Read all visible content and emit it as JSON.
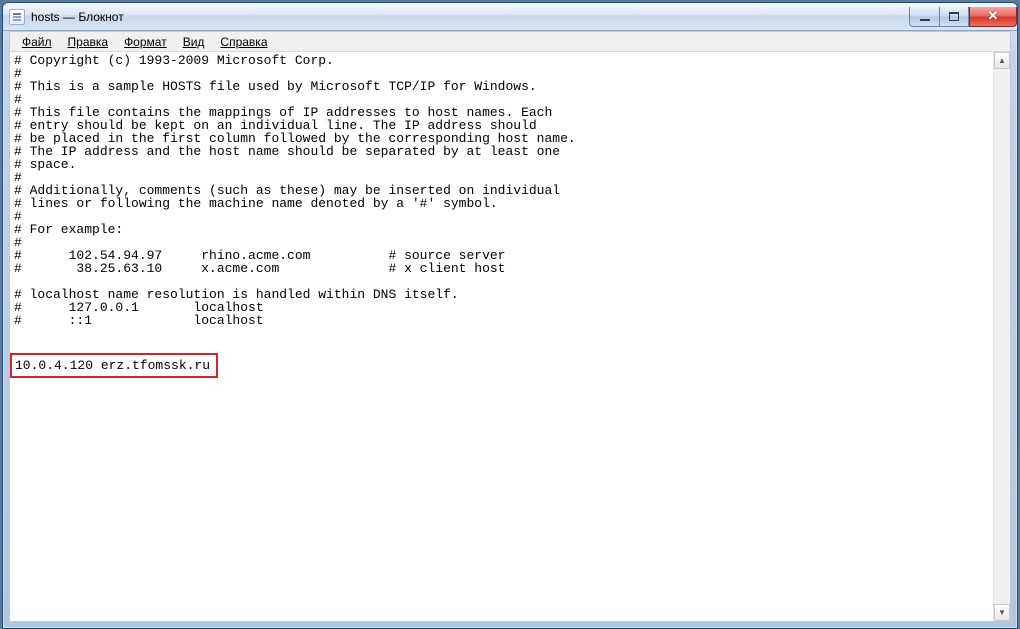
{
  "window": {
    "title": "hosts — Блокнот"
  },
  "menu": {
    "file": "Файл",
    "edit": "Правка",
    "format": "Формат",
    "view": "Вид",
    "help": "Справка"
  },
  "content": {
    "body": "# Copyright (c) 1993-2009 Microsoft Corp.\n#\n# This is a sample HOSTS file used by Microsoft TCP/IP for Windows.\n#\n# This file contains the mappings of IP addresses to host names. Each\n# entry should be kept on an individual line. The IP address should\n# be placed in the first column followed by the corresponding host name.\n# The IP address and the host name should be separated by at least one\n# space.\n#\n# Additionally, comments (such as these) may be inserted on individual\n# lines or following the machine name denoted by a '#' symbol.\n#\n# For example:\n#\n#      102.54.94.97     rhino.acme.com          # source server\n#       38.25.63.10     x.acme.com              # x client host\n\n# localhost name resolution is handled within DNS itself.\n#      127.0.0.1       localhost\n#      ::1             localhost",
    "highlighted": "10.0.4.120 erz.tfomssk.ru"
  }
}
